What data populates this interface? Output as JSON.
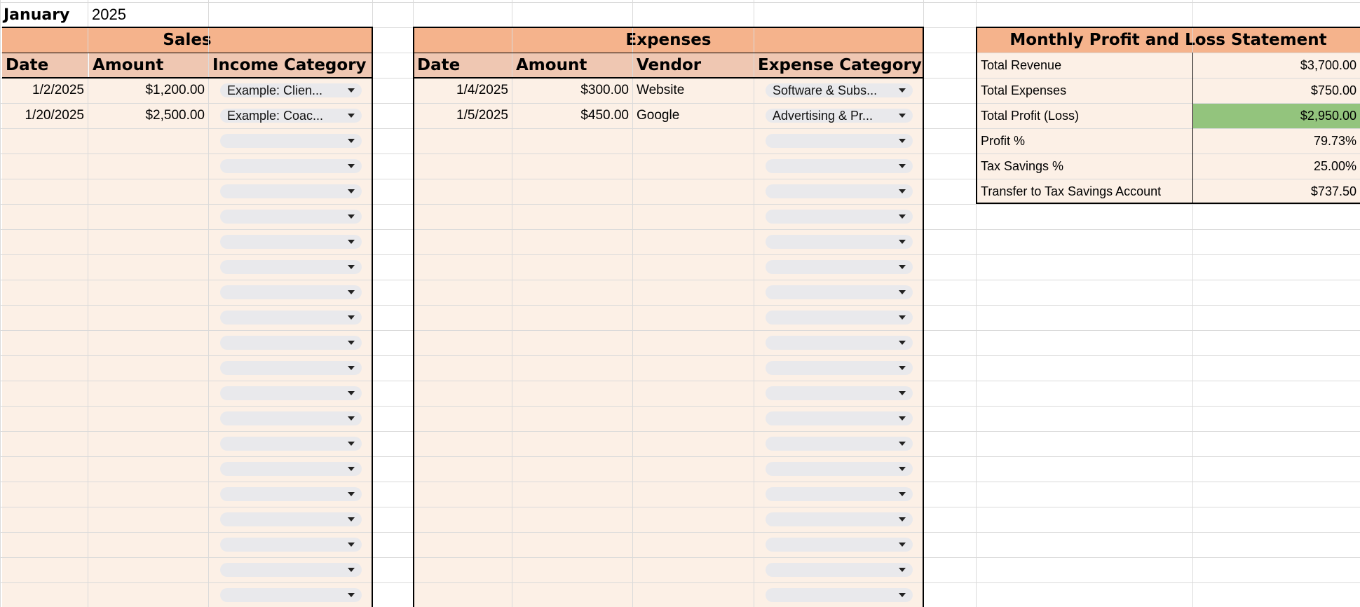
{
  "month": {
    "label": "January",
    "year": "2025"
  },
  "sales": {
    "title": "Sales",
    "columns": [
      "Date",
      "Amount",
      "Income Category"
    ],
    "rows": [
      {
        "date": "1/2/2025",
        "amount": "$1,200.00",
        "category": "Example: Clien..."
      },
      {
        "date": "1/20/2025",
        "amount": "$2,500.00",
        "category": "Example: Coac..."
      }
    ]
  },
  "expenses": {
    "title": "Expenses",
    "columns": [
      "Date",
      "Amount",
      "Vendor",
      "Expense Category"
    ],
    "rows": [
      {
        "date": "1/4/2025",
        "amount": "$300.00",
        "vendor": "Website",
        "category": "Software & Subs..."
      },
      {
        "date": "1/5/2025",
        "amount": "$450.00",
        "vendor": "Google",
        "category": "Advertising & Pr..."
      }
    ]
  },
  "pl": {
    "title": "Monthly Profit and Loss Statement",
    "rows": [
      {
        "label": "Total Revenue",
        "value": "$3,700.00"
      },
      {
        "label": "Total Expenses",
        "value": "$750.00"
      },
      {
        "label": "Total Profit (Loss)",
        "value": "$2,950.00"
      },
      {
        "label": "Profit %",
        "value": "79.73%"
      },
      {
        "label": "Tax Savings %",
        "value": "25.00%"
      },
      {
        "label": "Transfer to Tax Savings Account",
        "value": "$737.50"
      }
    ],
    "highlight_color": "#93c47d"
  },
  "colors": {
    "header": "#f5b38c",
    "subheader": "#efc7b2",
    "body": "#fcf0e6",
    "grid": "#dadada"
  },
  "icons": {
    "dropdown": "chevron-down-icon"
  }
}
